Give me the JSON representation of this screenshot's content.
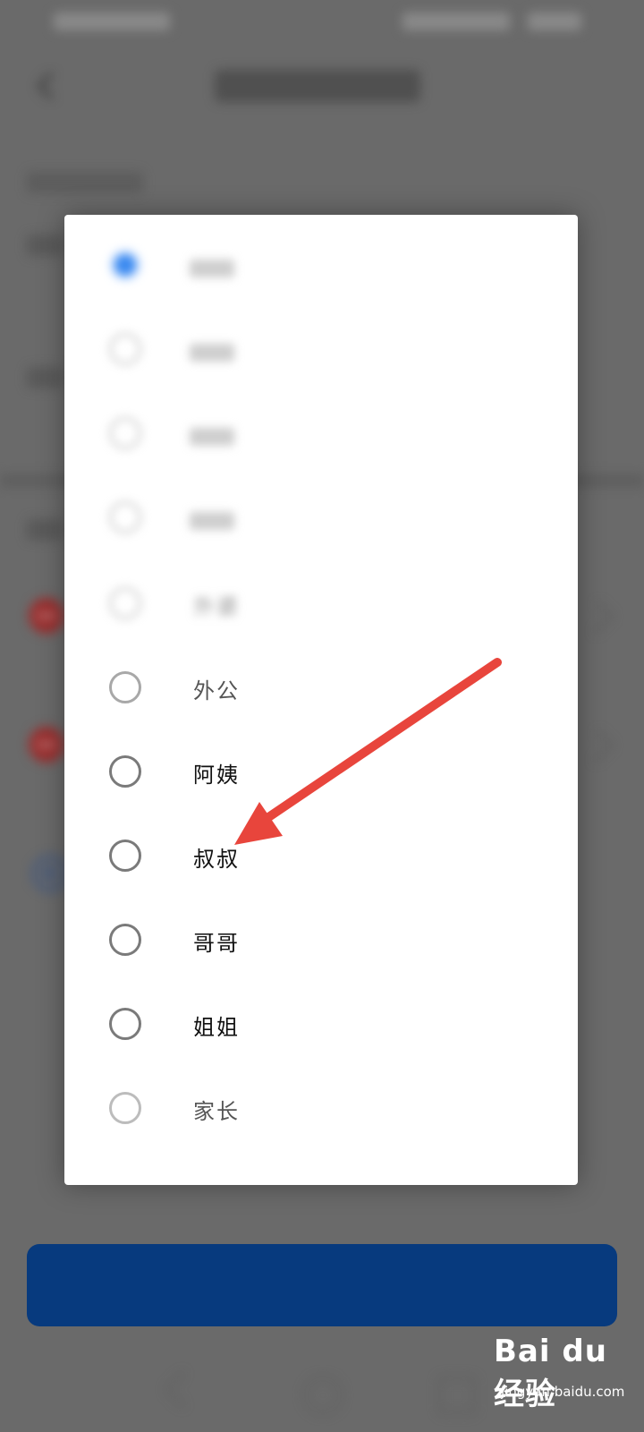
{
  "dialog": {
    "options": [
      {
        "label": "",
        "selected": true
      },
      {
        "label": "",
        "selected": false
      },
      {
        "label": "",
        "selected": false
      },
      {
        "label": "",
        "selected": false
      },
      {
        "label": "外婆",
        "selected": false
      },
      {
        "label": "外公",
        "selected": false
      },
      {
        "label": "阿姨",
        "selected": false
      },
      {
        "label": "叔叔",
        "selected": false
      },
      {
        "label": "哥哥",
        "selected": false
      },
      {
        "label": "姐姐",
        "selected": false
      },
      {
        "label": "家长",
        "selected": false
      }
    ]
  },
  "footer": {
    "confirm_label": ""
  },
  "watermark": {
    "logo": "Bai du 经验",
    "url": "jingyan.baidu.com"
  },
  "colors": {
    "accent": "#3d8bf0",
    "button": "#073a7e",
    "arrow": "#e8453c",
    "delete": "#9a2e2e"
  },
  "icons": {
    "back": "chevron-left-icon",
    "add": "plus-circle-icon",
    "remove": "minus-circle-icon",
    "annotation": "arrow-icon"
  }
}
